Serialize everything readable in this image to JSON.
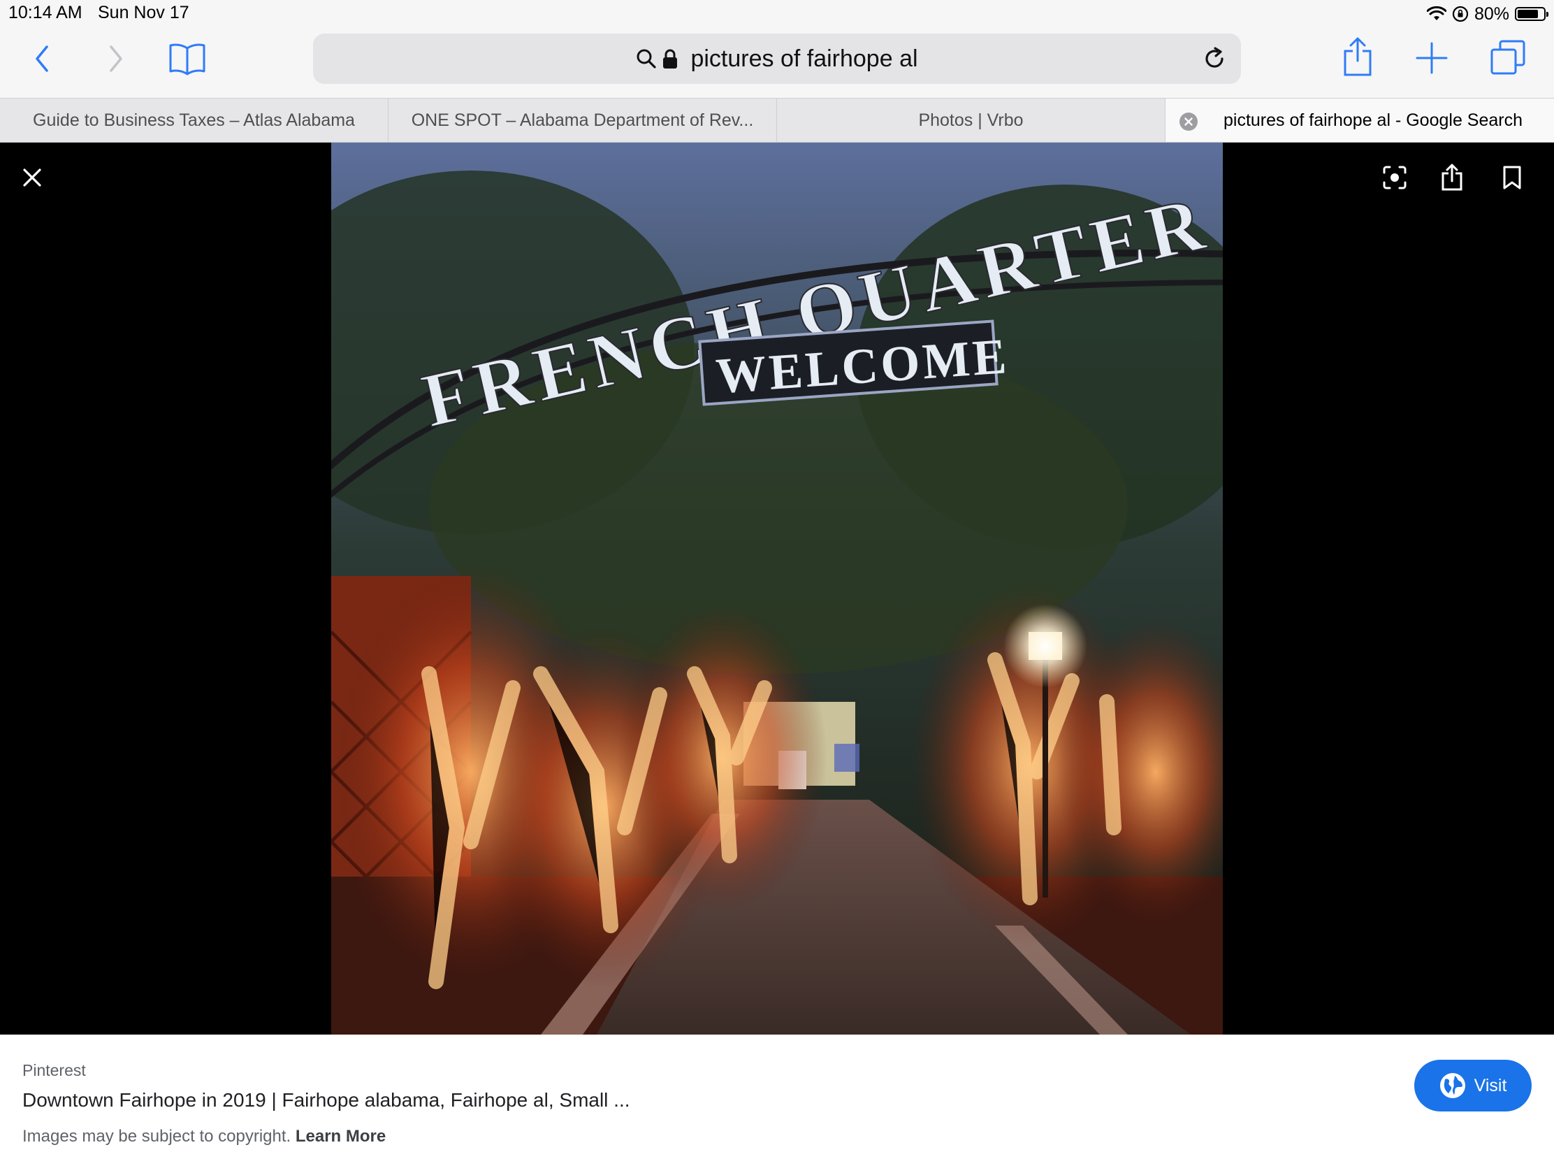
{
  "status_bar": {
    "time": "10:14 AM",
    "date": "Sun Nov 17",
    "battery": "80%",
    "battery_level": 0.8
  },
  "toolbar": {
    "back_icon": "chevron-left-icon",
    "forward_icon": "chevron-right-icon",
    "bookmarks_icon": "book-icon",
    "address": "pictures of fairhope al",
    "share_icon": "share-icon",
    "new_tab_icon": "plus-icon",
    "tabs_icon": "tabs-icon",
    "accent": "#2f7cf6"
  },
  "tabs": [
    {
      "label": "Guide to Business Taxes – Atlas Alabama",
      "active": false
    },
    {
      "label": "ONE SPOT – Alabama Department of Rev...",
      "active": false
    },
    {
      "label": "Photos | Vrbo",
      "active": false
    },
    {
      "label": "pictures of fairhope al - Google Search",
      "active": true
    }
  ],
  "viewer": {
    "close_icon": "close-icon",
    "lens_icon": "lens-icon",
    "share_icon": "share-icon",
    "bookmark_icon": "bookmark-icon",
    "photo": {
      "arch_text": "FRENCH QUARTER",
      "sign_text": "WELCOME"
    }
  },
  "info": {
    "source": "Pinterest",
    "title": "Downtown Fairhope in 2019 | Fairhope alabama, Fairhope al, Small ...",
    "copyright": "Images may be subject to copyright.",
    "learn_more": "Learn More",
    "visit_label": "Visit",
    "visit_color": "#1a73e8"
  }
}
